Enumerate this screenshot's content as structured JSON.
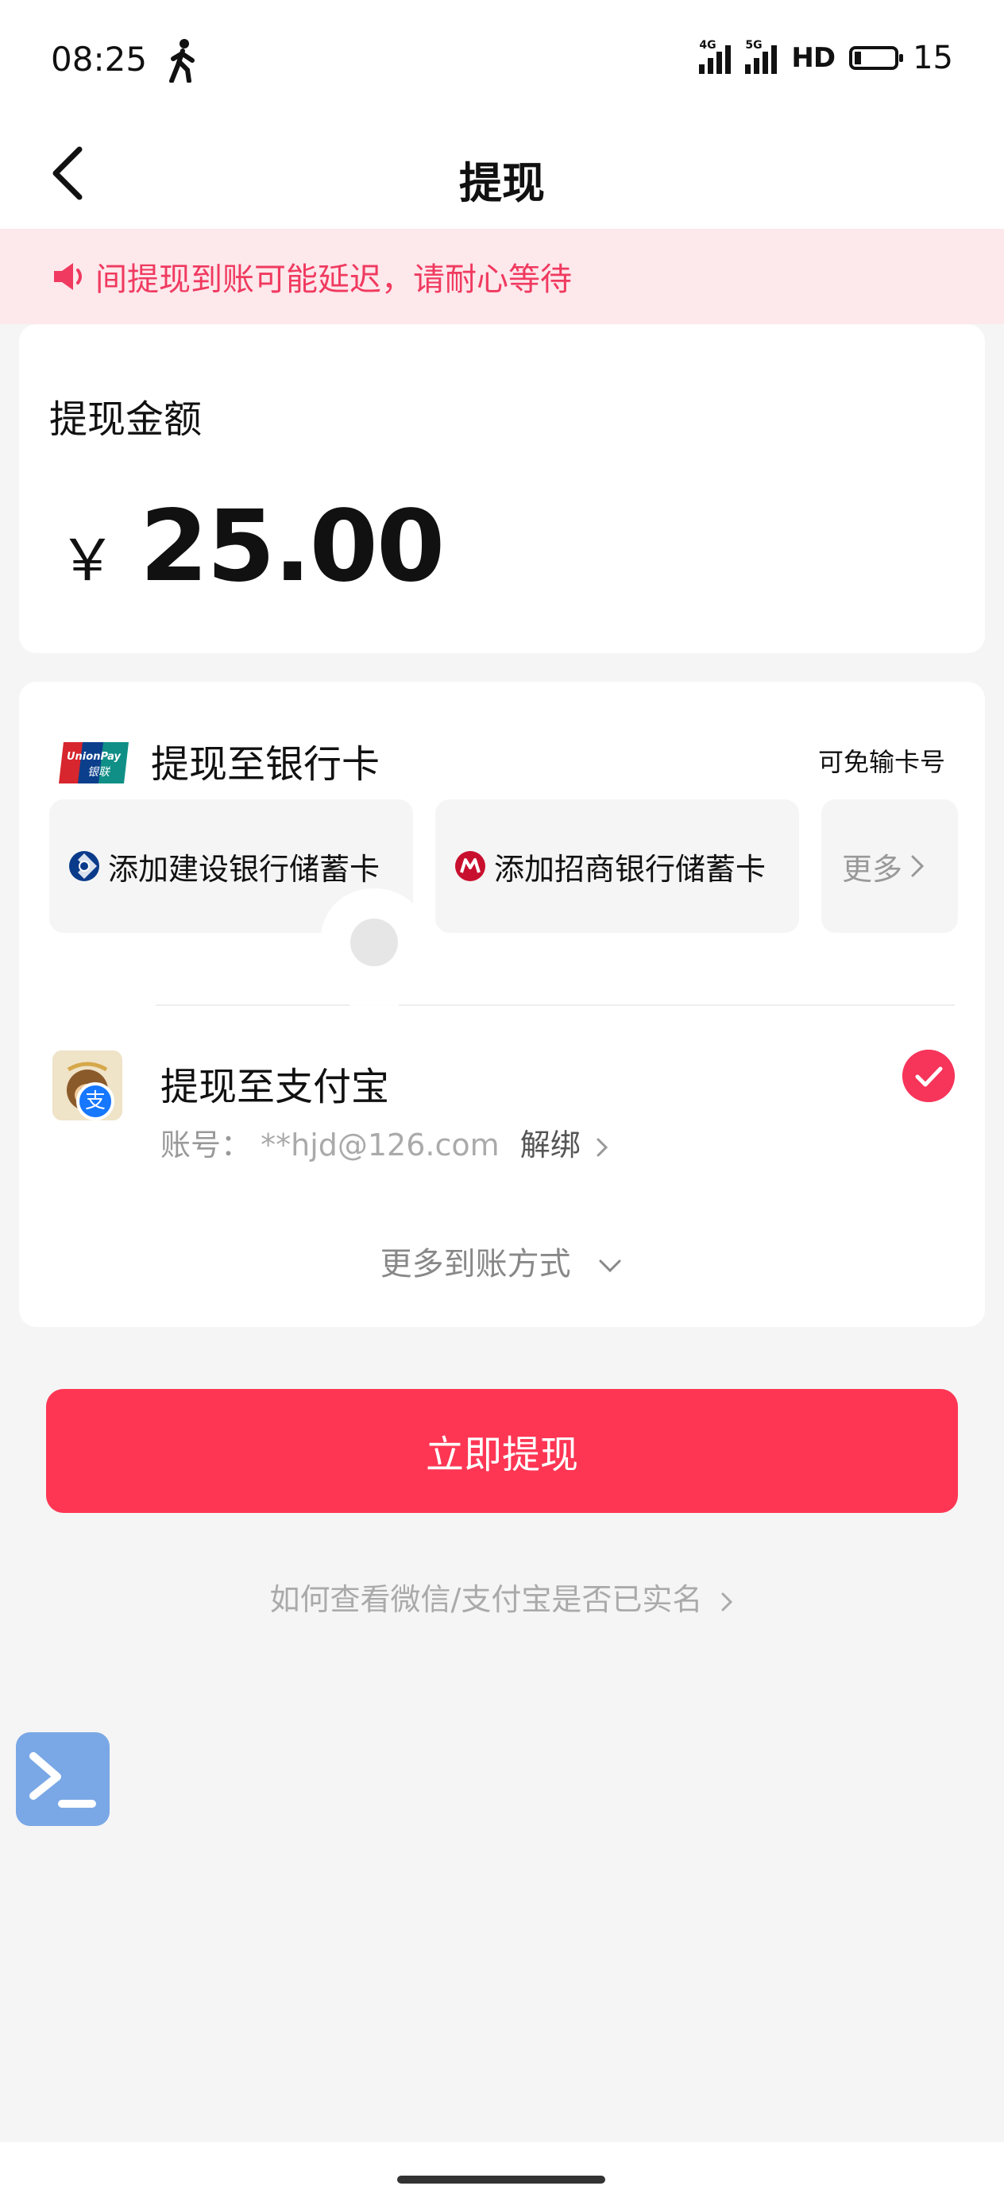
{
  "status": {
    "time": "08:25",
    "signal1_tag": "4G",
    "signal2_tag": "5G",
    "hd": "HD",
    "battery": "15"
  },
  "nav": {
    "title": "提现"
  },
  "notice": {
    "text": "节假日期间提现到账可能延迟，请耐心等待",
    "visible_text": "间提现到账可能延迟，请耐心等待"
  },
  "amount": {
    "label": "提现金额",
    "currency": "￥",
    "value": "25.00"
  },
  "bank": {
    "title": "提现至银行卡",
    "no_card_hint": "可免输卡号",
    "options": [
      {
        "label": "添加建设银行储蓄卡",
        "icon": "ccb-logo-icon"
      },
      {
        "label": "添加招商银行储蓄卡",
        "icon": "cmb-logo-icon"
      },
      {
        "label": "更多",
        "icon": "chevron-right-icon"
      }
    ]
  },
  "alipay": {
    "title": "提现至支付宝",
    "account_label": "账号：",
    "account_value": "**hjd@126.com",
    "unbind": "解绑",
    "badge": "支",
    "selected": true
  },
  "more_methods": "更多到账方式",
  "withdraw_button": "立即提现",
  "realname_link": "如何查看微信/支付宝是否已实名",
  "colors": {
    "accent": "#fe3654",
    "notice_bg": "#fde8ec",
    "notice_text": "#f03a5f",
    "alipay_blue": "#1677ff"
  }
}
